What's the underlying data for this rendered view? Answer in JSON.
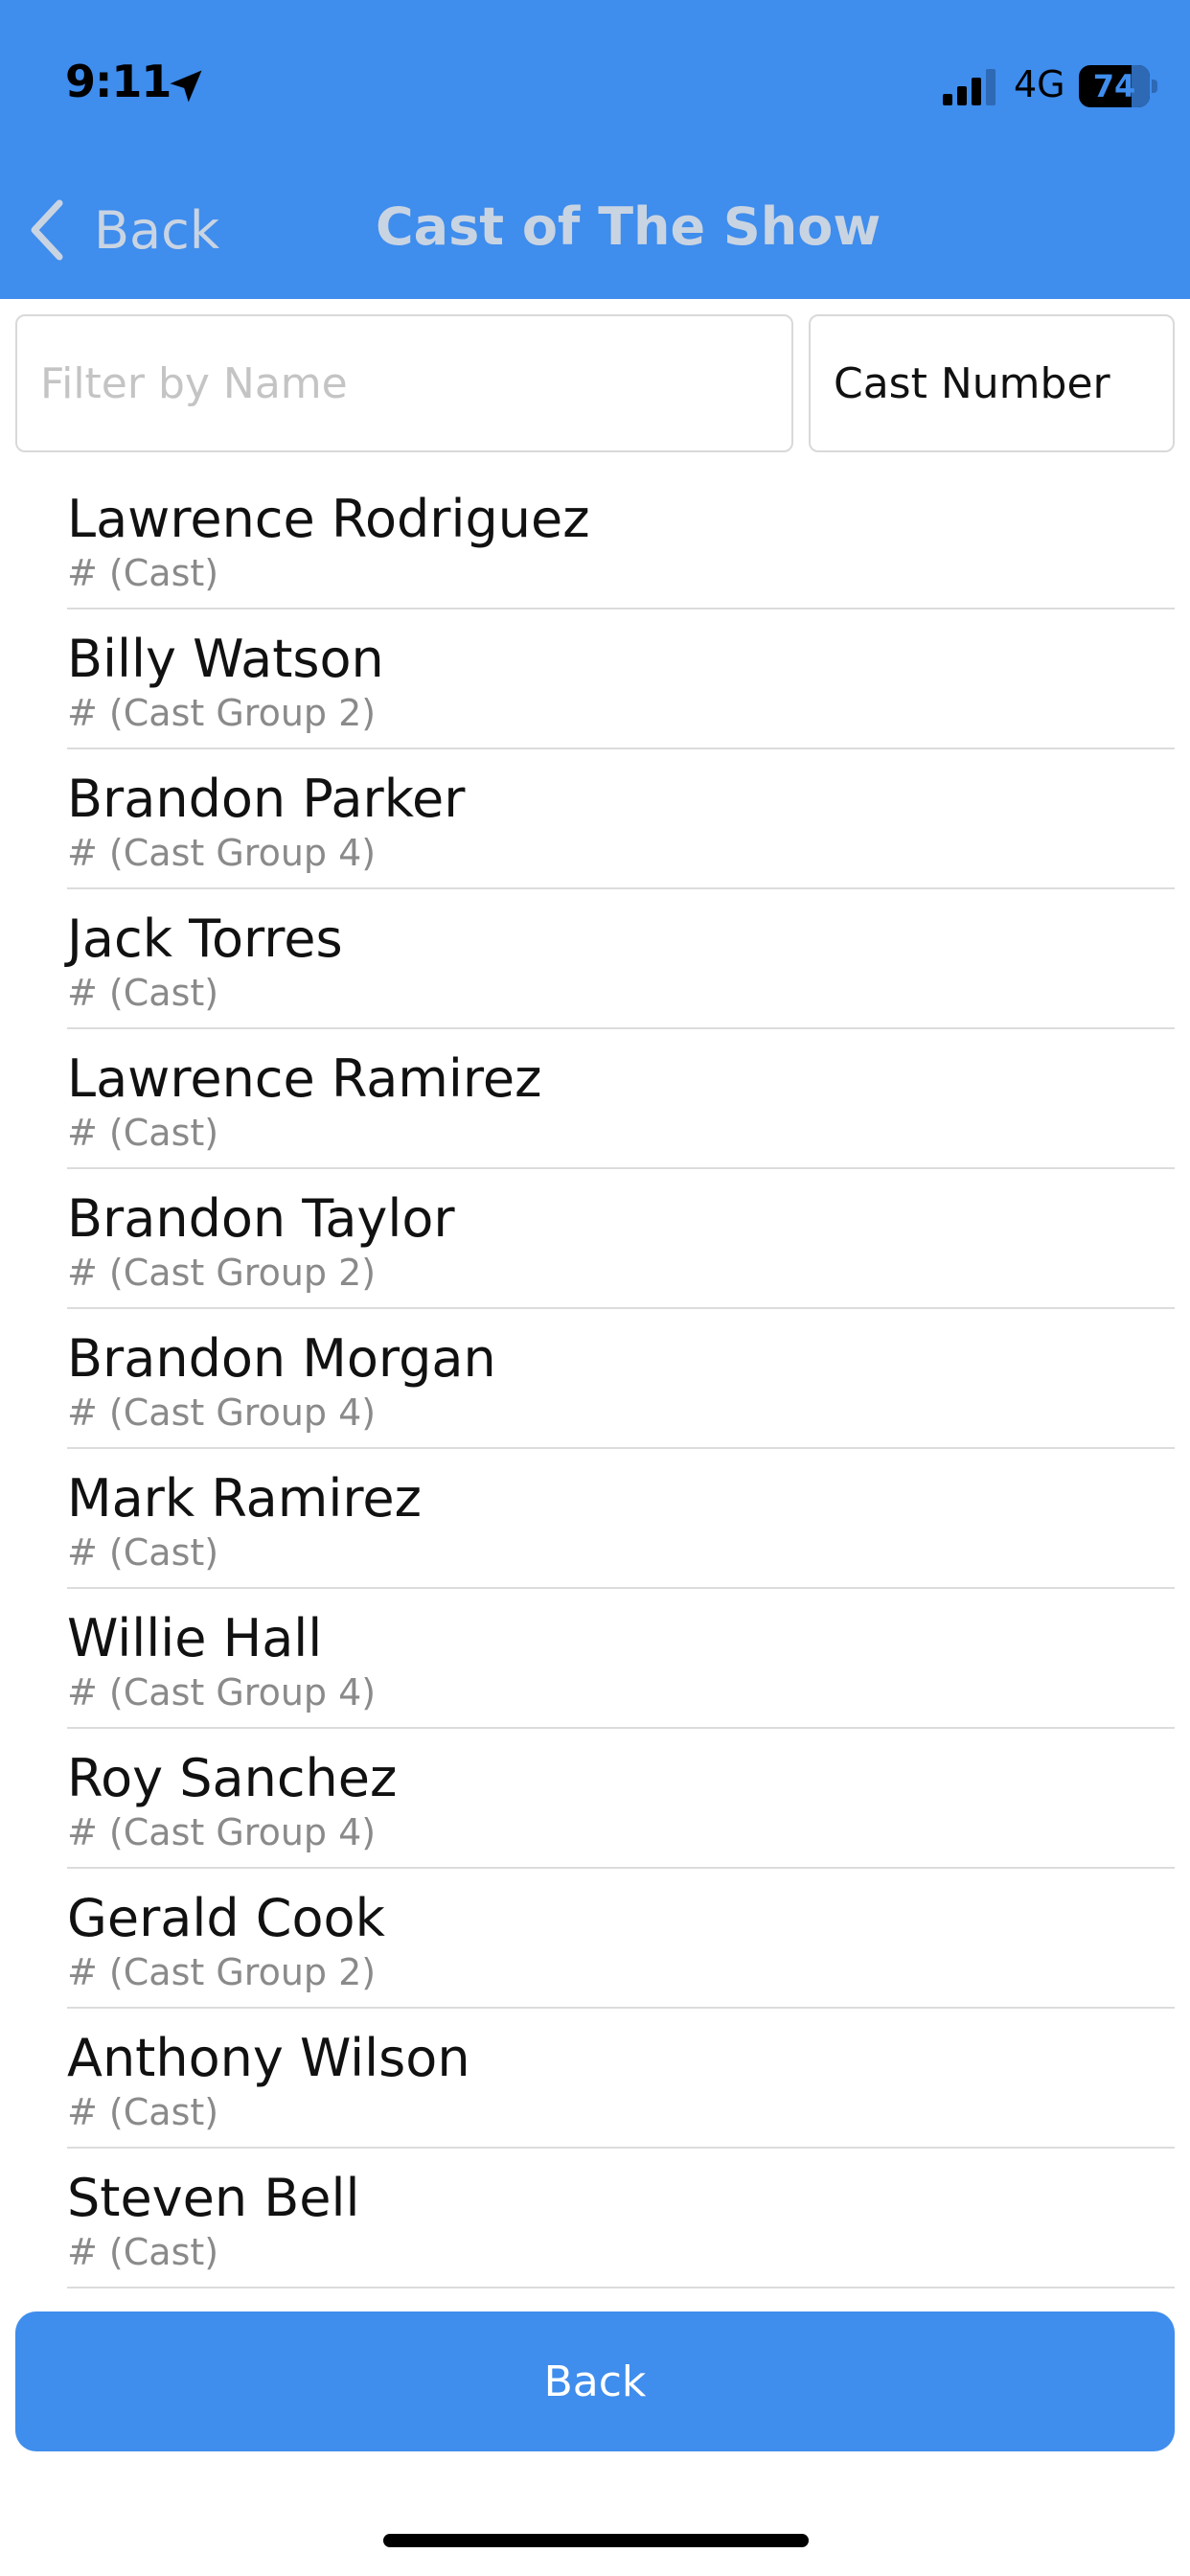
{
  "status_bar": {
    "time": "9:11",
    "network": "4G",
    "battery_level": "74",
    "battery_fraction": 0.74,
    "location_icon": "location-arrow-icon",
    "signal_icon": "cellular-signal-icon"
  },
  "nav": {
    "back_label": "Back",
    "back_icon": "chevron-left-icon",
    "title": "Cast of The Show"
  },
  "filter": {
    "placeholder": "Filter by Name",
    "value": ""
  },
  "sort": {
    "selected": "Cast Number"
  },
  "cast": [
    {
      "name": "Lawrence Rodriguez",
      "group": "# (Cast)"
    },
    {
      "name": "Billy Watson",
      "group": "# (Cast Group 2)"
    },
    {
      "name": "Brandon Parker",
      "group": "# (Cast Group 4)"
    },
    {
      "name": "Jack Torres",
      "group": "# (Cast)"
    },
    {
      "name": "Lawrence Ramirez",
      "group": "# (Cast)"
    },
    {
      "name": "Brandon Taylor",
      "group": "# (Cast Group 2)"
    },
    {
      "name": "Brandon Morgan",
      "group": "# (Cast Group 4)"
    },
    {
      "name": "Mark Ramirez",
      "group": "# (Cast)"
    },
    {
      "name": "Willie Hall",
      "group": "# (Cast Group 4)"
    },
    {
      "name": "Roy Sanchez",
      "group": "# (Cast Group 4)"
    },
    {
      "name": "Gerald Cook",
      "group": "# (Cast Group 2)"
    },
    {
      "name": "Anthony Wilson",
      "group": "# (Cast)"
    },
    {
      "name": "Steven Bell",
      "group": "# (Cast)"
    }
  ],
  "footer": {
    "back_button_label": "Back"
  },
  "colors": {
    "accent": "#3f8ded",
    "header_text": "#c9d4e2",
    "secondary_text": "#8a8a8a"
  }
}
